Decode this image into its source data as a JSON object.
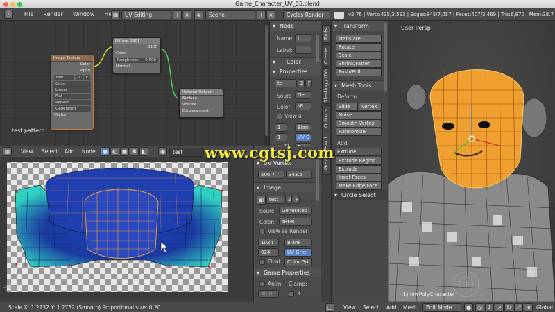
{
  "window": {
    "title": "Game_Character_UV_05.blend"
  },
  "menubar": {
    "items": [
      "File",
      "Render",
      "Window",
      "Help"
    ],
    "layout": "UV Editing",
    "scene": "Scene",
    "engine": "Cycles Render",
    "stats": "v2.76 | Verts:435/3,593 | Edges:845/7,057 | Faces:407/3,469 | Tris:6,870 | Mem:38.7"
  },
  "node_editor": {
    "image_texture": {
      "title": "Image Texture",
      "out_color": "Color",
      "out_alpha": "Alpha",
      "image": "test",
      "frame": "2",
      "f": "F",
      "color": "Color",
      "interp": "Linear",
      "proj": "Flat",
      "ext": "Repeat",
      "source": "Generated",
      "in_vector": "Vector"
    },
    "diffuse": {
      "title": "Diffuse BSDF",
      "out": "BSDF",
      "color": "Color",
      "roughness": "Roughness:",
      "roughness_val": "0.000",
      "normal": "Normal"
    },
    "output": {
      "title": "Material Output",
      "surface": "Surface",
      "volume": "Volume",
      "displacement": "Displacement"
    },
    "label": "test pattern"
  },
  "node_props": {
    "node_header": "Node",
    "name_label": "Name:",
    "name_value": "I",
    "label_label": "Label:",
    "label_value": "",
    "color_header": "Color",
    "properties_header": "Properties",
    "image": "te",
    "frame": "2",
    "f": "F",
    "source_label": "Sourc",
    "source_value": "Ge",
    "color_label": "Color",
    "color_value": "sR",
    "view_as": "View a",
    "w1": "1",
    "w2": "1",
    "blank": "Blan",
    "uvgrid": "UV G",
    "float": "Fl",
    "colorgrid": "Color"
  },
  "uv_header": {
    "view": "View",
    "select": "Select",
    "add": "Add",
    "node": "Node",
    "material": "test pattern"
  },
  "uv_props": {
    "uv_vertex_header": "UV Vertex",
    "uv_x": "506.7",
    "uv_y": "343.5",
    "image_header": "Image",
    "image": "test",
    "frame": "2",
    "f": "F",
    "source_label": "Sourc:",
    "source_value": "Generated",
    "color_label": "Color:",
    "color_value": "sRGB",
    "view_as_render": "View as Render",
    "w": "1024",
    "h": "024",
    "blank": "Blank",
    "uvgrid": "UV Grid",
    "float": "Float",
    "colorgrid": "Color Gri",
    "game_header": "Game Properties",
    "anim": "Anim",
    "clamp": "Clamp:",
    "st": "St: 0",
    "x": "X"
  },
  "uv_footer": {
    "text": "Scale X: 1.2732    Y: 1.2732 (Smooth) Proportional size: 0.20"
  },
  "tool_tabs": [
    "Tools",
    "Create",
    "Shading / UVs",
    "Options",
    "Grease Pencil"
  ],
  "tool_shelf": {
    "transform_header": "Transform",
    "transform": [
      "Translate",
      "Rotate",
      "Scale",
      "Shrink/Fatten",
      "Push/Pull"
    ],
    "mesh_tools_header": "Mesh Tools",
    "deform": "Deform:",
    "slide_edge": "Slide Ed",
    "vertex": "Vertex",
    "noise": "Noise",
    "smooth_vertex": "Smooth Vertex",
    "randomize": "Randomize",
    "add": "Add:",
    "extrude": "Extrude",
    "extrude_region": "Extrude Region",
    "extrude_individual": "Extrude Individual",
    "inset_faces": "Inset Faces",
    "make_edge_face": "Make Edge/Face",
    "circle_select_header": "Circle Select"
  },
  "viewport": {
    "label": "User Persp",
    "object": "(1) lowPolyCharacter",
    "footer": {
      "view": "View",
      "select": "Select",
      "add": "Add",
      "mesh": "Mesh",
      "mode": "Edit Mode",
      "orientation": "Global"
    }
  },
  "watermark": "www.cgtsj.com",
  "colors": {
    "accent": "#5680c2",
    "mesh_orange": "#f0a030",
    "uv_blue": "#1a3a9a",
    "uv_cyan": "#30d0c0"
  }
}
